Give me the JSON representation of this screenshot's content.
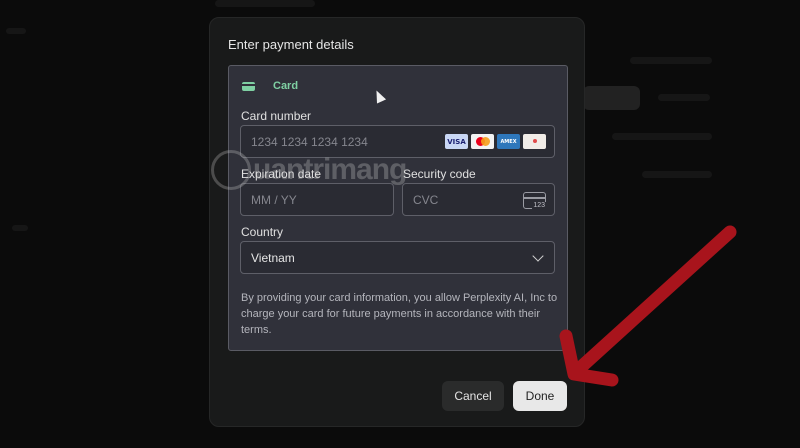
{
  "modal": {
    "title": "Enter payment details",
    "tab_label": "Card",
    "card_number": {
      "label": "Card number",
      "placeholder": "1234 1234 1234 1234",
      "brands": [
        "VISA",
        "mastercard",
        "AMEX",
        "unionpay"
      ]
    },
    "expiration": {
      "label": "Expiration date",
      "placeholder": "MM / YY"
    },
    "security": {
      "label": "Security code",
      "placeholder": "CVC",
      "icon_text": "123"
    },
    "country": {
      "label": "Country",
      "value": "Vietnam"
    },
    "disclaimer": "By providing your card information, you allow Perplexity AI, Inc to charge your card for future payments in accordance with their terms.",
    "cancel_label": "Cancel",
    "done_label": "Done"
  },
  "watermark": {
    "text": "uantrimang"
  },
  "colors": {
    "accent_green": "#7fd0a3",
    "annotation_arrow": "#a8141c"
  }
}
